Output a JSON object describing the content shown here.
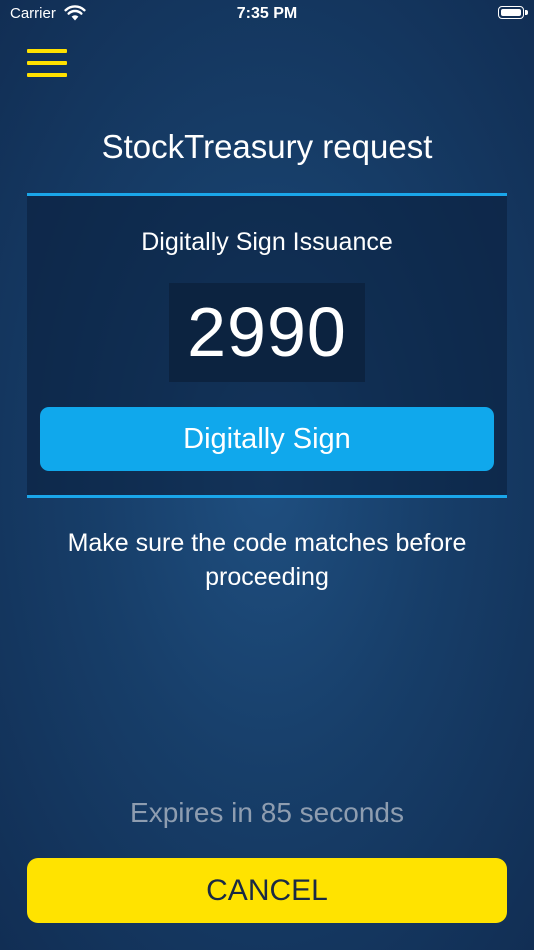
{
  "status_bar": {
    "carrier": "Carrier",
    "time": "7:35 PM"
  },
  "header": {
    "menu_icon": "hamburger-menu-icon",
    "title": "StockTreasury request"
  },
  "sign_panel": {
    "title": "Digitally Sign Issuance",
    "code": "2990",
    "sign_label": "Digitally Sign"
  },
  "instruction": "Make sure the code matches before proceeding",
  "expiry": "Expires in 85 seconds",
  "cancel_label": "CANCEL",
  "colors": {
    "accent_yellow": "#ffe300",
    "accent_blue": "#10a8ec",
    "panel_border": "#1aa6ea",
    "code_background": "#0c2340",
    "expiry_text": "#8e9db0"
  }
}
